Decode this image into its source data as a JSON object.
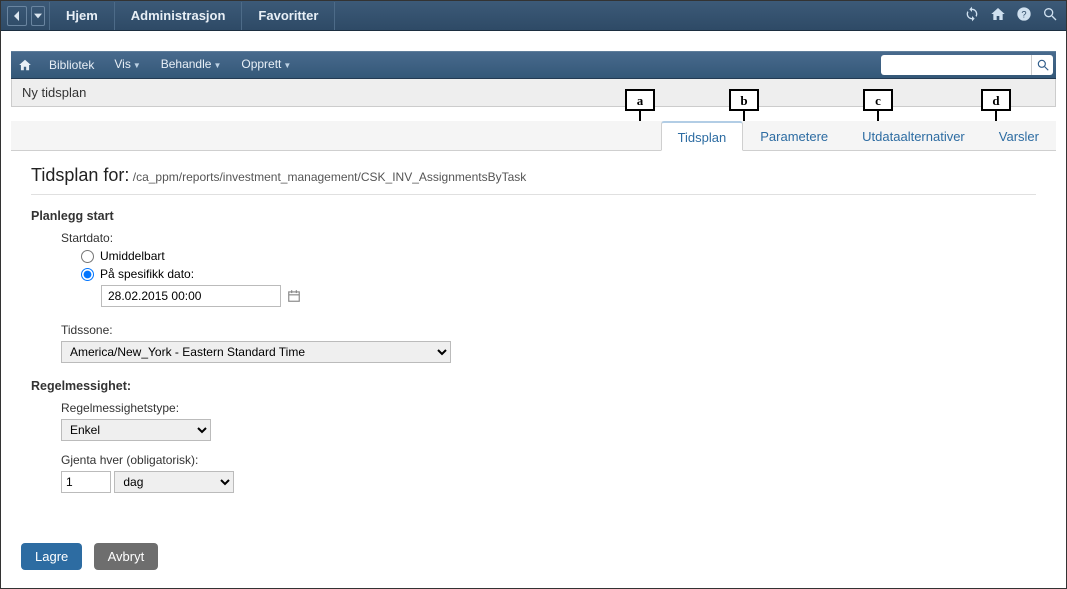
{
  "topnav": {
    "items": [
      "Hjem",
      "Administrasjon",
      "Favoritter"
    ]
  },
  "toolbar": {
    "items": [
      {
        "label": "Bibliotek",
        "dropdown": false
      },
      {
        "label": "Vis",
        "dropdown": true
      },
      {
        "label": "Behandle",
        "dropdown": true
      },
      {
        "label": "Opprett",
        "dropdown": true
      }
    ],
    "search_placeholder": ""
  },
  "title": "Ny tidsplan",
  "callouts": [
    "a",
    "b",
    "c",
    "d"
  ],
  "tabs": [
    {
      "label": "Tidsplan",
      "active": true
    },
    {
      "label": "Parametere",
      "active": false
    },
    {
      "label": "Utdataalternativer",
      "active": false
    },
    {
      "label": "Varsler",
      "active": false
    }
  ],
  "main": {
    "heading_prefix": "Tidsplan for:",
    "heading_path": "/ca_ppm/reports/investment_management/CSK_INV_AssignmentsByTask",
    "schedule_start": {
      "section": "Planlegg start",
      "startdate_label": "Startdato:",
      "opt_immediate": "Umiddelbart",
      "opt_specific": "På spesifikk dato:",
      "selected": "specific",
      "date_value": "28.02.2015 00:00",
      "timezone_label": "Tidssone:",
      "timezone_value": "America/New_York - Eastern Standard Time"
    },
    "recurrence": {
      "section": "Regelmessighet:",
      "type_label": "Regelmessighetstype:",
      "type_value": "Enkel",
      "repeat_label": "Gjenta hver (obligatorisk):",
      "repeat_value": "1",
      "repeat_unit": "dag"
    }
  },
  "footer": {
    "save": "Lagre",
    "cancel": "Avbryt"
  }
}
